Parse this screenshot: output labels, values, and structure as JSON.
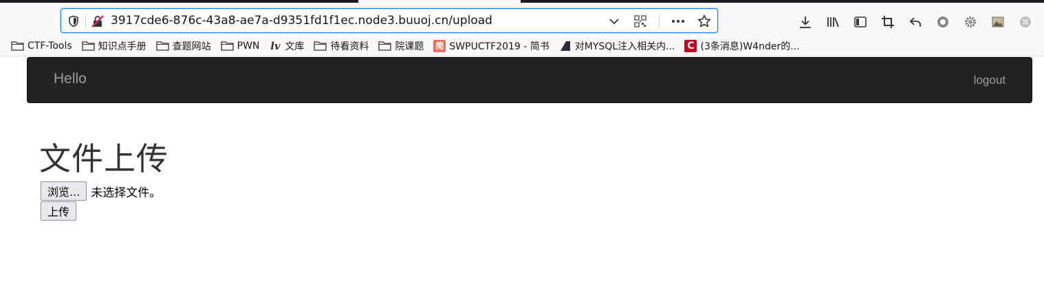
{
  "browser": {
    "url": "3917cde6-876c-43a8-ae7a-d9351fd1f1ec.node3.buuoj.cn/upload",
    "icons": {
      "shield": "tracking-protection-shield-icon",
      "lock": "insecure-connection-icon",
      "dropdown": "chevron-down-icon",
      "qr": "qr-code-icon",
      "more": "more-actions-icon",
      "bookmark_star": "star-icon",
      "download": "download-icon",
      "library": "library-icon",
      "sidebar": "sidebar-icon",
      "crop": "screenshot-icon",
      "back_arrow": "undo-arrow-icon",
      "circle": "extension-circle-icon",
      "gear": "gear-icon",
      "picture": "picture-icon",
      "extra": "extension-icon"
    },
    "bookmarks": [
      {
        "label": "CTF-Tools",
        "icon": "folder-icon"
      },
      {
        "label": "知识点手册",
        "icon": "folder-icon"
      },
      {
        "label": "查题网站",
        "icon": "folder-icon"
      },
      {
        "label": "PWN",
        "icon": "folder-icon"
      },
      {
        "label": "文库",
        "icon": "lv-logo-icon"
      },
      {
        "label": "待看资料",
        "icon": "folder-icon"
      },
      {
        "label": "院课题",
        "icon": "folder-icon"
      },
      {
        "label": "SWPUCTF2019 - 简书",
        "icon": "jianshu-favicon"
      },
      {
        "label": "对MYSQL注入相关内...",
        "icon": "dark-favicon"
      },
      {
        "label": "(3条消息)W4nder的...",
        "icon": "csdn-favicon"
      }
    ]
  },
  "navbar": {
    "brand": "Hello",
    "logout": "logout"
  },
  "main": {
    "title": "文件上传",
    "browse_button": "浏览...",
    "file_status": "未选择文件。",
    "upload_button": "上传"
  },
  "colors": {
    "navbar_bg": "#222222",
    "navbar_text": "#9d9d9d",
    "url_focus": "#0a84ff",
    "jianshu": "#ea6f5a",
    "csdn": "#c9001c"
  }
}
